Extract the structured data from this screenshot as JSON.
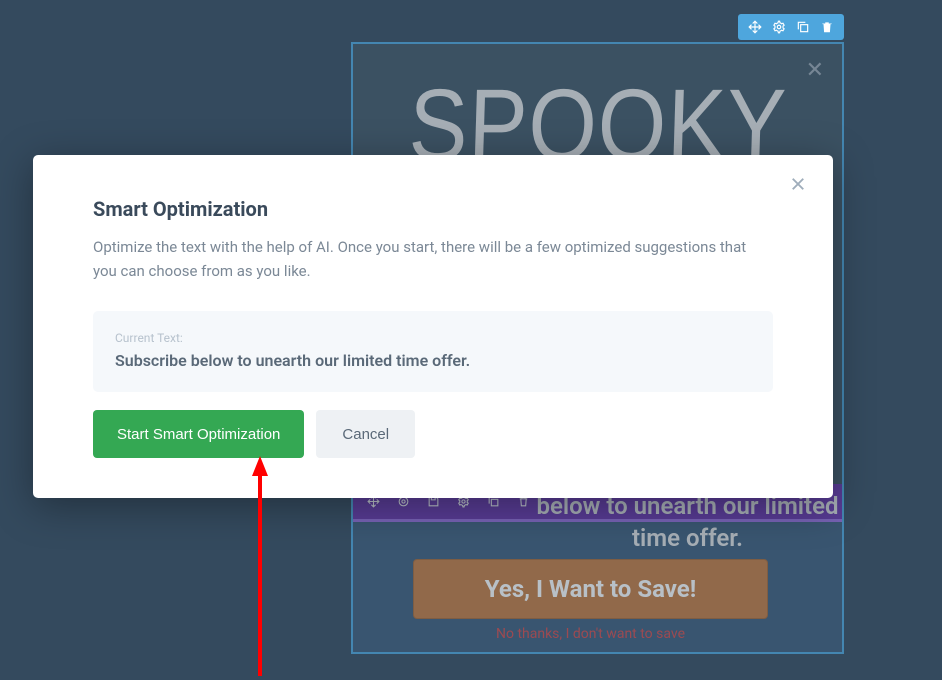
{
  "toolbar": {
    "icons": [
      "move",
      "settings",
      "duplicate",
      "delete"
    ]
  },
  "preview": {
    "heroTitle": "SPOOKY",
    "innerIcons": [
      "move",
      "target",
      "save",
      "settings",
      "duplicate",
      "delete"
    ],
    "taglineText": "below to unearth our limited time offer.",
    "ctaLabel": "Yes, I Want to Save!",
    "declineLabel": "No thanks, I don't want to save"
  },
  "modal": {
    "title": "Smart Optimization",
    "description": "Optimize the text with the help of AI. Once you start, there will be a few optimized suggestions that you can choose from as you like.",
    "currentLabel": "Current Text:",
    "currentText": "Subscribe below to unearth our limited time offer.",
    "startLabel": "Start Smart Optimization",
    "cancelLabel": "Cancel"
  }
}
